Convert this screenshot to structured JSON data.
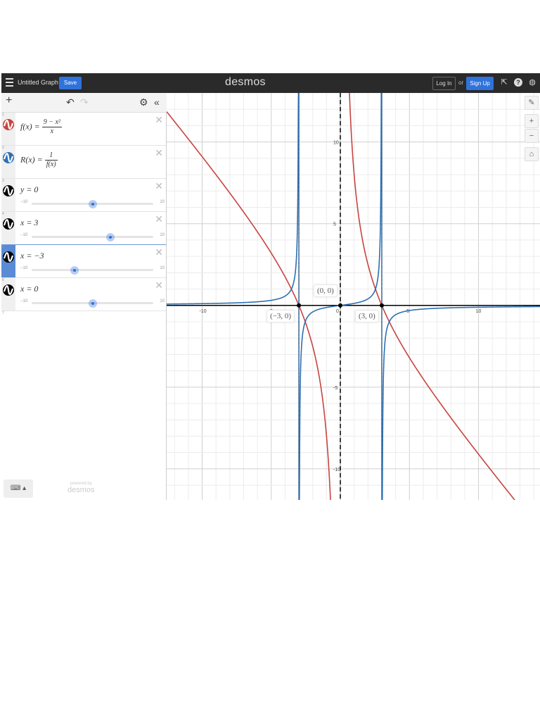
{
  "topbar": {
    "title": "Untitled Graph",
    "save": "Save",
    "logo": "desmos",
    "login": "Log In",
    "or": "or",
    "signup": "Sign Up"
  },
  "expressions": [
    {
      "num": "1",
      "color": "#c74440",
      "lhs": "f(x) =",
      "num_text": "9 − x²",
      "den_text": "x"
    },
    {
      "num": "2",
      "color": "#2d70b3",
      "lhs": "R(x) =",
      "num_text": "1",
      "den_text": "f(x)"
    },
    {
      "num": "3",
      "color": "#000000",
      "text": "y = 0",
      "min": "−10",
      "max": "10",
      "value": 0
    },
    {
      "num": "4",
      "color": "#000000",
      "text": "x = 3",
      "min": "−10",
      "max": "10",
      "value": 3
    },
    {
      "num": "5",
      "color": "#000000",
      "text": "x = −3",
      "min": "−10",
      "max": "10",
      "value": -3,
      "selected": true
    },
    {
      "num": "6",
      "color": "#000000",
      "text": "x = 0",
      "min": "−10",
      "max": "10",
      "value": 0
    },
    {
      "num": "7"
    }
  ],
  "powered": {
    "a": "powered by",
    "b": "desmos"
  },
  "graph": {
    "xmin": -12.57,
    "xmax": 14.45,
    "ymin": -11.9,
    "ymax": 13.0,
    "x_ticks": [
      "-10",
      "-5",
      "0",
      "5",
      "10"
    ],
    "y_ticks": [
      "10",
      "5",
      "-5",
      "-10"
    ],
    "points": [
      {
        "x": -3,
        "y": 0,
        "label": "(−3, 0)"
      },
      {
        "x": 0,
        "y": 0,
        "label": "(0, 0)"
      },
      {
        "x": 3,
        "y": 0,
        "label": "(3, 0)"
      }
    ],
    "red": "#c74440",
    "blue": "#2d70b3"
  }
}
